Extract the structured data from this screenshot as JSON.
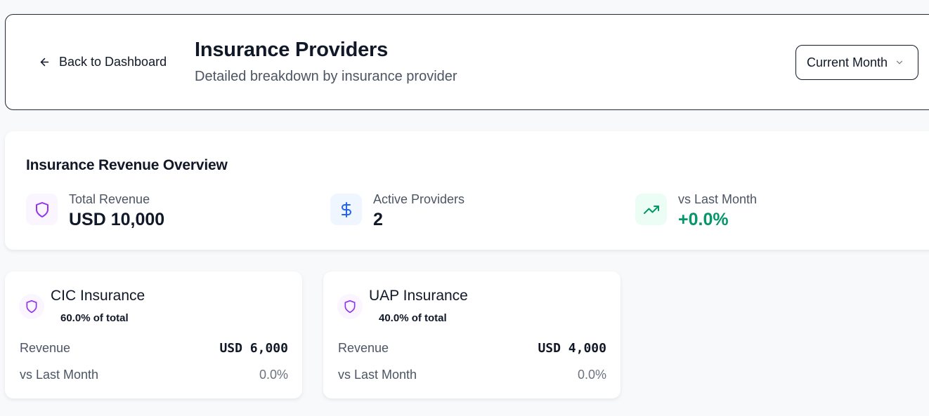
{
  "header": {
    "back_label": "Back to Dashboard",
    "title": "Insurance Providers",
    "subtitle": "Detailed breakdown by insurance provider",
    "period_select": "Current Month"
  },
  "overview": {
    "title": "Insurance Revenue Overview",
    "stats": [
      {
        "label": "Total Revenue",
        "value": "USD 10,000",
        "icon": "shield-icon",
        "icon_color": "#9333ea",
        "bg": "#faf5ff"
      },
      {
        "label": "Active Providers",
        "value": "2",
        "icon": "dollar-icon",
        "icon_color": "#2563eb",
        "bg": "#eff6ff"
      },
      {
        "label": "vs Last Month",
        "value": "+0.0%",
        "icon": "trending-up-icon",
        "icon_color": "#059669",
        "bg": "#ecfdf5"
      }
    ]
  },
  "providers": [
    {
      "name": "CIC Insurance",
      "share": "60.0% of total",
      "revenue_label": "Revenue",
      "revenue": "USD 6,000",
      "change_label": "vs Last Month",
      "change": "0.0%"
    },
    {
      "name": "UAP Insurance",
      "share": "40.0% of total",
      "revenue_label": "Revenue",
      "revenue": "USD 4,000",
      "change_label": "vs Last Month",
      "change": "0.0%"
    }
  ],
  "colors": {
    "positive": "#059669",
    "accent_purple": "#9333ea",
    "accent_blue": "#2563eb"
  }
}
